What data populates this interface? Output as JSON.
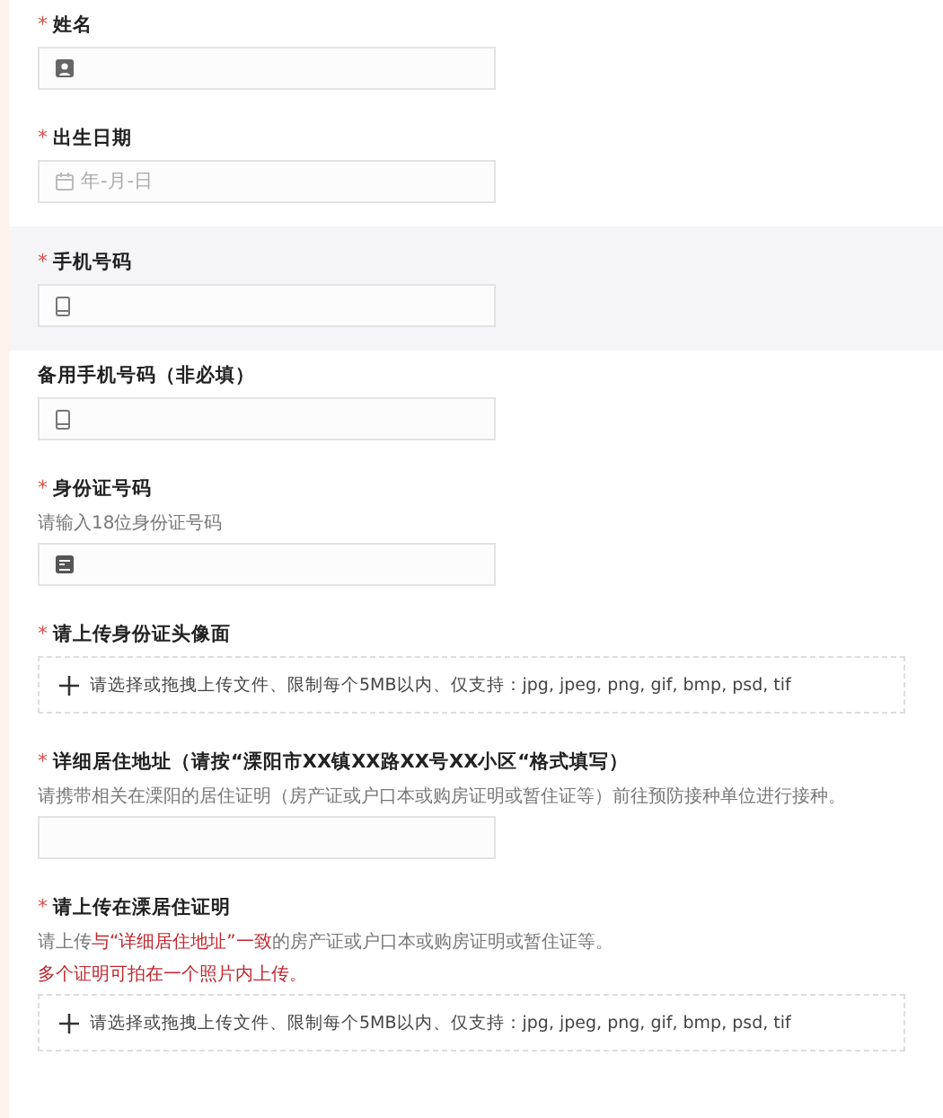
{
  "fields": [
    {
      "required_mark": "*",
      "label": "姓名",
      "kind": "name"
    },
    {
      "required_mark": "*",
      "label": "出生日期",
      "kind": "date",
      "placeholder": "年-月-日"
    },
    {
      "required_mark": "*",
      "label": "手机号码",
      "highlighted": true,
      "kind": "phone"
    },
    {
      "label": "备用手机号码（非必填）",
      "kind": "phone"
    },
    {
      "required_mark": "*",
      "label": "身份证号码",
      "kind": "idcard",
      "hints": [
        [
          {
            "text": "请输入18位身份证号码"
          }
        ]
      ]
    },
    {
      "required_mark": "*",
      "label": "请上传身份证头像面",
      "kind": "upload",
      "placeholder": "请选择或拖拽上传文件、限制每个5MB以内、仅支持：jpg, jpeg, png, gif, bmp, psd, tif"
    },
    {
      "required_mark": "*",
      "label": "详细居住地址（请按“溧阳市XX镇XX路XX号XX小区“格式填写）",
      "kind": "plain",
      "hints": [
        [
          {
            "text": "请携带相关在溧阳的居住证明（房产证或户口本或购房证明或暂住证等）前往预防接种单位进行接种。"
          }
        ]
      ]
    },
    {
      "required_mark": "*",
      "label": "请上传在溧居住证明",
      "kind": "upload",
      "placeholder": "请选择或拖拽上传文件、限制每个5MB以内、仅支持：jpg, jpeg, png, gif, bmp, psd, tif",
      "hints": [
        [
          {
            "text": "请上传"
          },
          {
            "text": "与“详细居住地址”一致",
            "alert": true
          },
          {
            "text": "的房产证或户口本或购房证明或暂住证等。"
          }
        ],
        [
          {
            "text": "多个证明可拍在一个照片内上传。",
            "alert": true
          }
        ]
      ]
    }
  ]
}
